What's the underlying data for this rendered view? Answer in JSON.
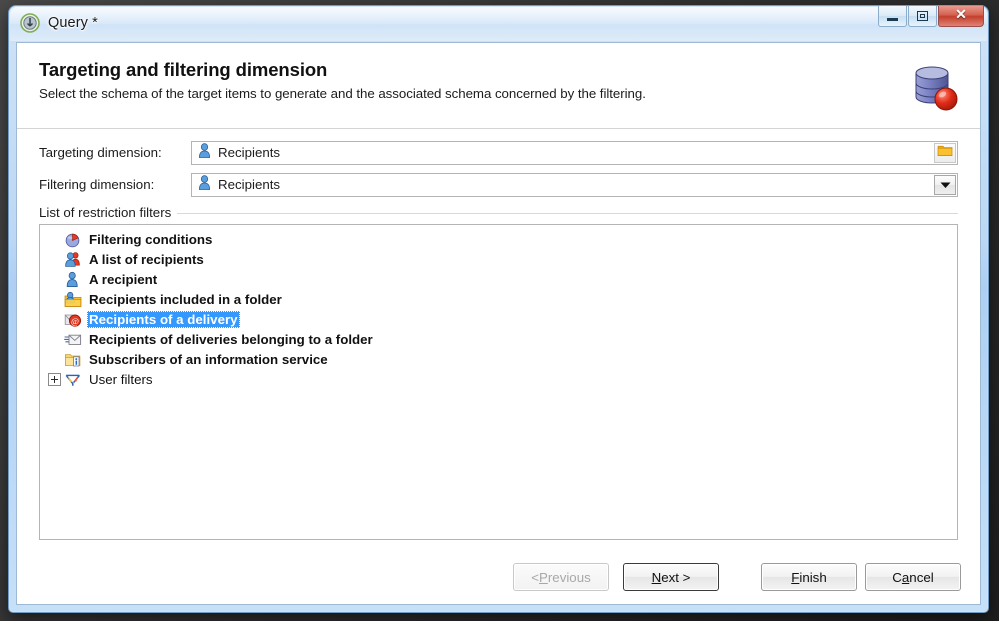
{
  "window": {
    "title": "Query *",
    "app_icon": "query-app-icon",
    "controls": {
      "minimize": "minimize-button",
      "maximize": "maximize-button",
      "close": "close-button",
      "close_glyph": "✕"
    }
  },
  "header": {
    "title": "Targeting and filtering dimension",
    "subtitle": "Select the schema of the target items to  generate and the associated schema concerned by the filtering.",
    "icon": "database-red-sphere-icon"
  },
  "form": {
    "rows": [
      {
        "label": "Targeting dimension:",
        "value": "Recipients",
        "value_icon": "recipient-person-icon",
        "button": "folder-browse-button",
        "button_icon": "folder-icon"
      },
      {
        "label": "Filtering dimension:",
        "value": "Recipients",
        "value_icon": "recipient-person-icon",
        "button": "dropdown-button",
        "button_icon": "chevron-down-icon"
      }
    ]
  },
  "group": {
    "legend": "List of restriction filters",
    "items": [
      {
        "label": "Filtering conditions",
        "icon": "pie-chart-icon",
        "bold": true,
        "selected": false,
        "expandable": false
      },
      {
        "label": "A list of recipients",
        "icon": "recipient-list-icon",
        "bold": true,
        "selected": false,
        "expandable": false
      },
      {
        "label": "A recipient",
        "icon": "recipient-person-icon",
        "bold": true,
        "selected": false,
        "expandable": false
      },
      {
        "label": "Recipients included in a folder",
        "icon": "recipients-folder-icon",
        "bold": true,
        "selected": false,
        "expandable": false
      },
      {
        "label": "Recipients of a delivery",
        "icon": "delivery-at-icon",
        "bold": true,
        "selected": true,
        "expandable": false
      },
      {
        "label": "Recipients of deliveries belonging to a folder",
        "icon": "deliveries-folder-envelope-icon",
        "bold": true,
        "selected": false,
        "expandable": false
      },
      {
        "label": "Subscribers of an information service",
        "icon": "information-service-folder-icon",
        "bold": true,
        "selected": false,
        "expandable": false
      },
      {
        "label": "User filters",
        "icon": "user-filters-funnel-icon",
        "bold": false,
        "selected": false,
        "expandable": true
      }
    ]
  },
  "footer": {
    "previous": {
      "pre": "< ",
      "accel": "P",
      "post": "revious",
      "disabled": true
    },
    "next": {
      "pre": "",
      "accel": "N",
      "post": "ext >",
      "disabled": false,
      "default": true
    },
    "finish": {
      "pre": "",
      "accel": "F",
      "post": "inish",
      "disabled": false
    },
    "cancel": {
      "pre": "C",
      "accel": "a",
      "post": "ncel",
      "disabled": false
    }
  },
  "colors": {
    "selection": "#3399ff",
    "title_gradient_top": "#cfe3f7",
    "close_button": "#c23f2c",
    "folder_yellow": "#f0b429"
  }
}
